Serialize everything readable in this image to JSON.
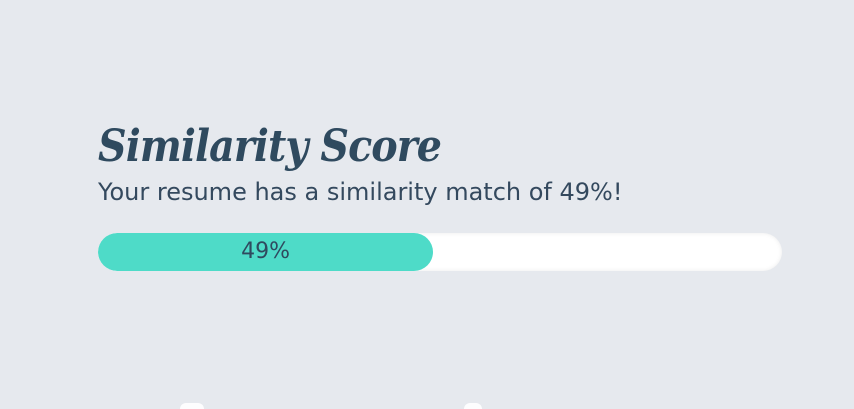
{
  "score": {
    "title": "Similarity Score",
    "subtitle": "Your resume has a similarity match of 49%!",
    "progress_label": "49%",
    "progress_fraction": 0.49
  },
  "colors": {
    "background": "#e6e9ee",
    "title": "#2f4a5f",
    "progress_fill": "#4edbc8",
    "progress_track": "#ffffff"
  }
}
